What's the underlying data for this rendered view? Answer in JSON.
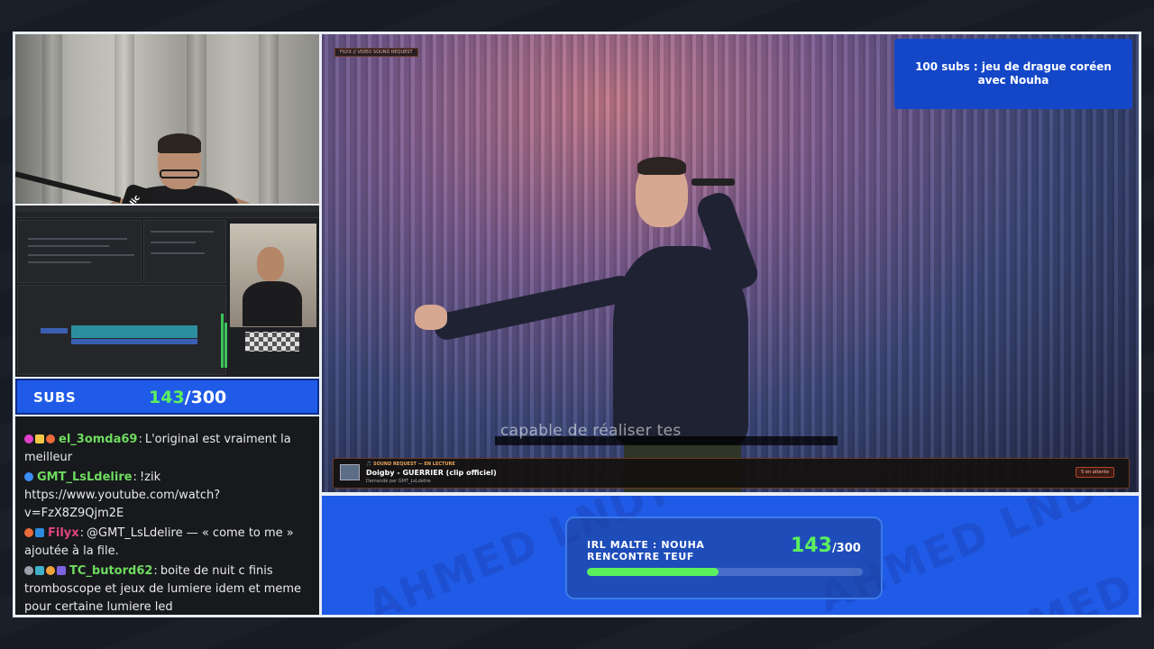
{
  "subs": {
    "label": "SUBS",
    "current": "143",
    "target": "/300",
    "progress": 0.477
  },
  "chat": [
    {
      "badges": [
        "#e040c8",
        "#f2c744",
        "#e96c3a"
      ],
      "user": "el_3omda69",
      "color": "#6edb5e",
      "text": "L'original est vraiment la meilleur"
    },
    {
      "badges": [
        "#3a8ef5"
      ],
      "user": "GMT_LsLdelire",
      "color": "#6edb5e",
      "text": "!zik https://www.youtube.com/watch?v=FzX8Z9Qjm2E"
    },
    {
      "badges": [
        "#e96c3a",
        "#2f8ce0"
      ],
      "user": "Filyx",
      "color": "#e0457b",
      "text": "@GMT_LsLdelire — « come to me » ajoutée à la file."
    },
    {
      "badges": [
        "#9aa0aa",
        "#3fb0c9",
        "#f2a23a",
        "#7d62e0"
      ],
      "user": "TC_butord62",
      "color": "#6edb5e",
      "text": "boite de nuit c finis tromboscope et jeux de lumiere idem et meme pour certaine lumiere led"
    }
  ],
  "video": {
    "tag": "FILYX // VIDEO SOUND REQUEST",
    "subtitle": "capable de réaliser tes"
  },
  "overlay": {
    "goal_text": "100 subs : jeu de drague coréen avec Nouha"
  },
  "now_playing": {
    "kicker": "🎵 SOUND REQUEST — EN LECTURE",
    "title": "Doigby - GUERRIER (clip officiel)",
    "requested_by": "Demandé par GMT_LsLdelire",
    "status": "5 en attente"
  },
  "goal": {
    "label": "IRL MALTE : NOUHA RENCONTRE TEUF",
    "current": "143",
    "target": "/300",
    "progress": 0.477,
    "watermark": "AHMED LNDY"
  },
  "colors": {
    "accent_blue": "#1f5be6",
    "accent_green": "#5cf05e"
  }
}
